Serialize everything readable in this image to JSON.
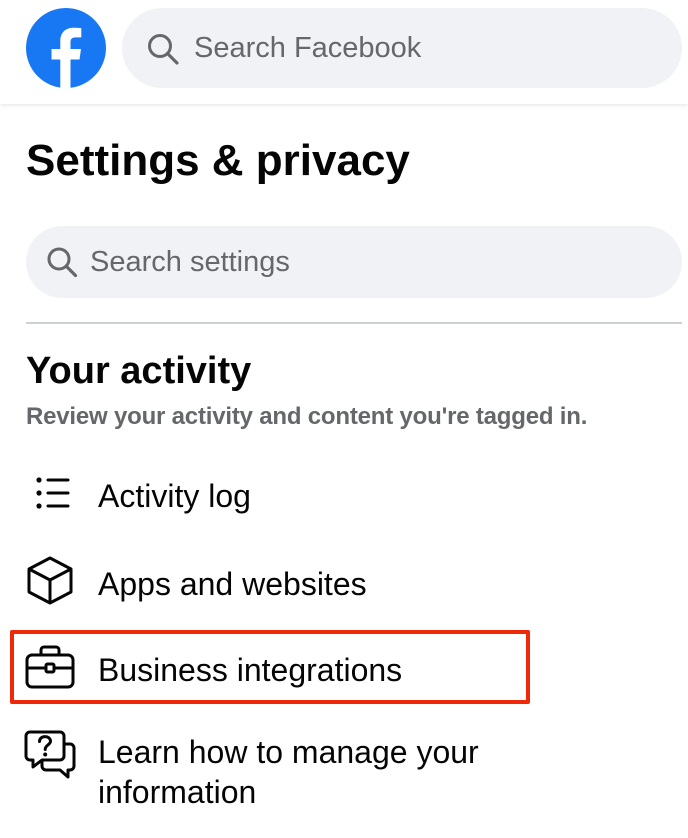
{
  "header": {
    "logo_icon": "facebook-logo-icon",
    "brand_color": "#1877F2",
    "search_placeholder": "Search Facebook",
    "search_icon": "search-icon"
  },
  "page": {
    "title": "Settings & privacy",
    "search_placeholder": "Search settings",
    "search_icon": "search-icon"
  },
  "section": {
    "title": "Your activity",
    "subtitle": "Review your activity and content you're tagged in.",
    "items": [
      {
        "label": "Activity log",
        "icon": "list-icon"
      },
      {
        "label": "Apps and websites",
        "icon": "cube-icon"
      },
      {
        "label": "Business integrations",
        "icon": "briefcase-icon",
        "highlighted": true
      },
      {
        "label": "Learn how to manage your information",
        "icon": "question-chat-icon"
      }
    ]
  },
  "colors": {
    "highlight": "#F0280A",
    "search_bg": "#F0F2F5",
    "secondary_text": "#65676B"
  }
}
